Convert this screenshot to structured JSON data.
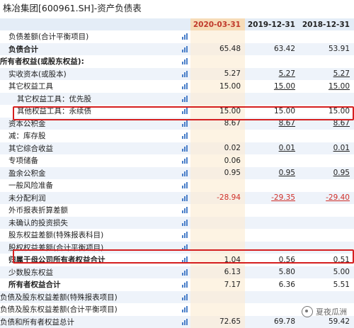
{
  "title": "株冶集团[600961.SH]-资产负债表",
  "columns": [
    "2020-03-31",
    "2019-12-31",
    "2018-12-31"
  ],
  "rows": [
    {
      "label": "负债差额(合计平衡项目)",
      "indent": 2,
      "bold": false,
      "values": [
        "",
        "",
        ""
      ]
    },
    {
      "label": "负债合计",
      "indent": 2,
      "bold": true,
      "values": [
        "65.48",
        "63.42",
        "53.91"
      ]
    },
    {
      "label": "所有者权益(或股东权益):",
      "indent": 0,
      "bold": true,
      "values": [
        "",
        "",
        ""
      ]
    },
    {
      "label": "实收资本(或股本)",
      "indent": 2,
      "bold": false,
      "values": [
        "5.27",
        "5.27",
        "5.27"
      ],
      "underline": [
        false,
        true,
        true
      ]
    },
    {
      "label": "其它权益工具",
      "indent": 2,
      "bold": false,
      "values": [
        "15.00",
        "15.00",
        "15.00"
      ],
      "underline": [
        false,
        true,
        true
      ]
    },
    {
      "label": "其它权益工具：优先股",
      "indent": 4,
      "bold": false,
      "values": [
        "",
        "",
        ""
      ]
    },
    {
      "label": "其他权益工具：永续债",
      "indent": 4,
      "bold": false,
      "values": [
        "15.00",
        "15.00",
        "15.00"
      ]
    },
    {
      "label": "资本公积金",
      "indent": 2,
      "bold": false,
      "values": [
        "8.67",
        "8.67",
        "8.67"
      ],
      "underline": [
        false,
        true,
        true
      ]
    },
    {
      "label": "减：库存股",
      "indent": 2,
      "bold": false,
      "values": [
        "",
        "",
        ""
      ]
    },
    {
      "label": "其它综合收益",
      "indent": 2,
      "bold": false,
      "values": [
        "0.02",
        "0.01",
        "0.01"
      ],
      "underline": [
        false,
        true,
        true
      ]
    },
    {
      "label": "专项储备",
      "indent": 2,
      "bold": false,
      "values": [
        "0.06",
        "",
        ""
      ]
    },
    {
      "label": "盈余公积金",
      "indent": 2,
      "bold": false,
      "values": [
        "0.95",
        "0.95",
        "0.95"
      ],
      "underline": [
        false,
        true,
        true
      ]
    },
    {
      "label": "一般风险准备",
      "indent": 2,
      "bold": false,
      "values": [
        "",
        "",
        ""
      ]
    },
    {
      "label": "未分配利润",
      "indent": 2,
      "bold": false,
      "values": [
        "-28.94",
        "-29.35",
        "-29.40"
      ],
      "underline": [
        false,
        true,
        true
      ],
      "negative": true
    },
    {
      "label": "外币报表折算差额",
      "indent": 2,
      "bold": false,
      "values": [
        "",
        "",
        ""
      ]
    },
    {
      "label": "未确认的投资损失",
      "indent": 2,
      "bold": false,
      "values": [
        "",
        "",
        ""
      ]
    },
    {
      "label": "股东权益差额(特殊报表科目)",
      "indent": 2,
      "bold": false,
      "values": [
        "",
        "",
        ""
      ]
    },
    {
      "label": "股权权益差额(合计平衡项目)",
      "indent": 2,
      "bold": false,
      "values": [
        "",
        "",
        ""
      ]
    },
    {
      "label": "归属于母公司所有者权益合计",
      "indent": 2,
      "bold": true,
      "values": [
        "1.04",
        "0.56",
        "0.51"
      ]
    },
    {
      "label": "少数股东权益",
      "indent": 2,
      "bold": false,
      "values": [
        "6.13",
        "5.80",
        "5.00"
      ]
    },
    {
      "label": "所有者权益合计",
      "indent": 2,
      "bold": true,
      "values": [
        "7.17",
        "6.36",
        "5.51"
      ]
    },
    {
      "label": "负债及股东权益差额(特殊报表项目)",
      "indent": 0,
      "bold": false,
      "values": [
        "",
        "",
        ""
      ]
    },
    {
      "label": "负债及股东权益差额(合计平衡项目)",
      "indent": 0,
      "bold": false,
      "values": [
        "",
        "",
        ""
      ]
    },
    {
      "label": "负债和所有者权益总计",
      "indent": 0,
      "bold": false,
      "values": [
        "72.65",
        "69.78",
        "59.42"
      ]
    }
  ],
  "chart_icon": "bar-chart-icon",
  "highlight_rows": [
    "其他权益工具：永续债",
    "归属于母公司所有者权益合计"
  ],
  "watermark": "夏夜瓜洲",
  "colors": {
    "header": "#e4edf7",
    "highlight_col": "#f6dcb8",
    "negative": "#d0302a",
    "box": "#d51f1f",
    "icon": "#4a7fc9"
  }
}
